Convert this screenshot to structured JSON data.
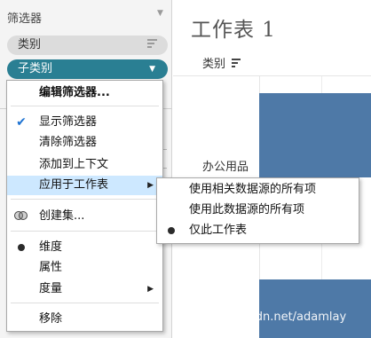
{
  "filters_pane": {
    "header": "筛选器",
    "pills": [
      {
        "label": "类别"
      },
      {
        "label": "子类别"
      }
    ]
  },
  "worksheet": {
    "title": "工作表 1",
    "column_header": "类别",
    "row_label": "办公用品",
    "bar_color": "#4e79a7",
    "watermark": "https://blog.csdn.net/adamlay"
  },
  "context_menu": {
    "items": [
      {
        "label": "编辑筛选器...",
        "bold": true
      },
      {
        "label": "显示筛选器",
        "mark": "check"
      },
      {
        "label": "清除筛选器"
      },
      {
        "label": "添加到上下文"
      },
      {
        "label": "应用于工作表",
        "submenu": true,
        "highlighted": true
      },
      {
        "label": "创建集...",
        "icon": "sets-icon"
      },
      {
        "label": "维度",
        "mark": "dot"
      },
      {
        "label": "属性"
      },
      {
        "label": "度量",
        "submenu": true
      },
      {
        "label": "移除"
      }
    ]
  },
  "submenu": {
    "items": [
      {
        "label": "使用相关数据源的所有项"
      },
      {
        "label": "使用此数据源的所有项"
      },
      {
        "label": "仅此工作表",
        "mark": "dot"
      }
    ]
  },
  "colors": {
    "accent_pill": "#2a7f93",
    "highlight": "#cde8ff",
    "check": "#1e73d2"
  }
}
